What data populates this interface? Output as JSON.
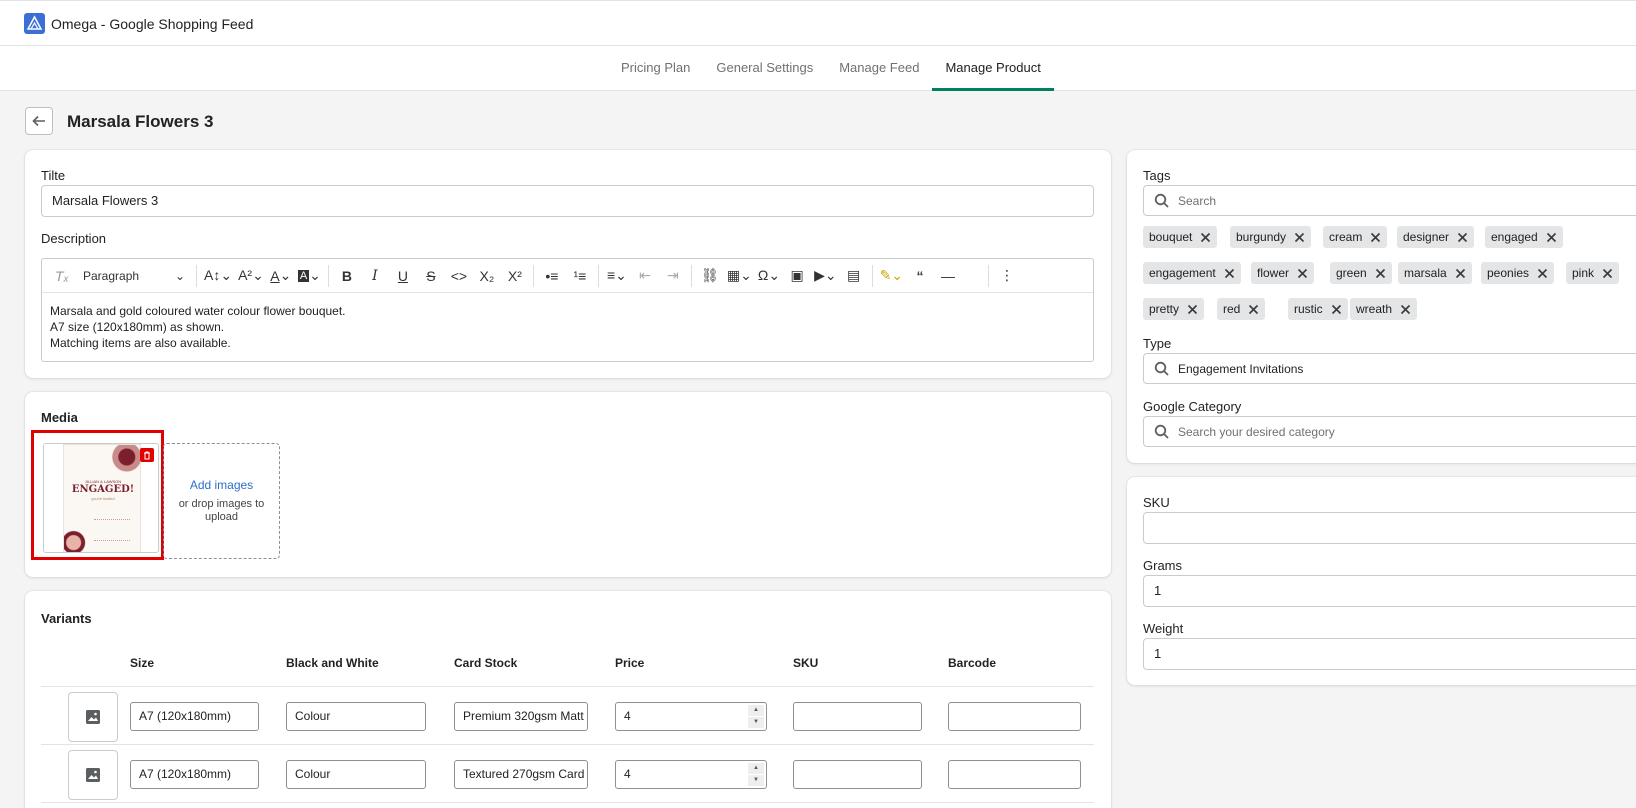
{
  "app": {
    "title": "Omega - Google Shopping Feed"
  },
  "nav": {
    "tabs": [
      {
        "label": "Pricing Plan"
      },
      {
        "label": "General Settings"
      },
      {
        "label": "Manage Feed"
      },
      {
        "label": "Manage Product"
      }
    ],
    "active": "Manage Product"
  },
  "page": {
    "title": "Marsala Flowers 3"
  },
  "details": {
    "title_label": "Tilte",
    "title_value": "Marsala Flowers 3",
    "description_label": "Description",
    "paragraph_select": "Paragraph",
    "description_lines": [
      "Marsala and gold coloured water colour flower bouquet.",
      "A7 size (120x180mm) as shown.",
      "Matching items are also available."
    ]
  },
  "media": {
    "title": "Media",
    "add_images": "Add images",
    "drop_text": "or drop images to upload",
    "thumbnail": {
      "line1": "JILLIAN & LAWSON",
      "line2": "ENGAGED!",
      "line3": "you're invited"
    }
  },
  "variants": {
    "title": "Variants",
    "columns": [
      "Size",
      "Black and White",
      "Card Stock",
      "Price",
      "SKU",
      "Barcode"
    ],
    "rows": [
      {
        "size": "A7 (120x180mm)",
        "bw": "Colour",
        "stock": "Premium 320gsm Matt",
        "price": "4",
        "sku": "",
        "barcode": ""
      },
      {
        "size": "A7 (120x180mm)",
        "bw": "Colour",
        "stock": "Textured 270gsm Card",
        "price": "4",
        "sku": "",
        "barcode": ""
      }
    ]
  },
  "organization": {
    "tags_label": "Tags",
    "tags_placeholder": "Search",
    "tags": [
      "bouquet",
      "burgundy",
      "cream",
      "designer",
      "engaged",
      "engagement",
      "flower",
      "green",
      "marsala",
      "peonies",
      "pink",
      "pretty",
      "red",
      "rustic",
      "wreath"
    ],
    "type_label": "Type",
    "type_value": "Engagement Invitations",
    "category_label": "Google Category",
    "category_placeholder": "Search your desired category"
  },
  "inventory": {
    "sku_label": "SKU",
    "sku_value": "",
    "grams_label": "Grams",
    "grams_value": "1",
    "weight_label": "Weight",
    "weight_value": "1"
  },
  "colors": {
    "accent": "#008060",
    "link": "#2c6ecb",
    "highlight": "#e00000"
  }
}
